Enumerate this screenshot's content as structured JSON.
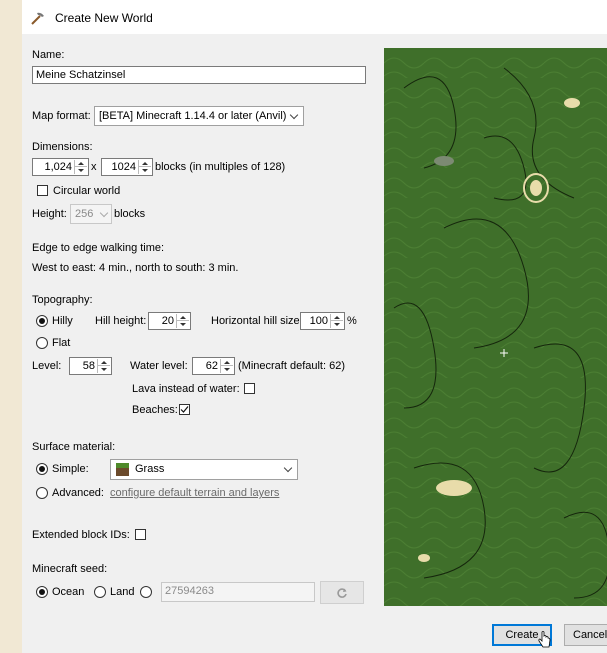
{
  "window": {
    "title": "Create New World"
  },
  "name": {
    "label": "Name:",
    "value": "Meine Schatzinsel"
  },
  "map_format": {
    "label": "Map format:",
    "value": "[BETA] Minecraft 1.14.4 or later (Anvil)"
  },
  "dimensions": {
    "label": "Dimensions:",
    "width": "1,024",
    "x_sep": "x",
    "height": "1024",
    "unit_text": "blocks (in multiples of 128)",
    "circular_label": "Circular world",
    "circular_checked": false
  },
  "height": {
    "label": "Height:",
    "value": "256",
    "unit": "blocks"
  },
  "walking": {
    "title": "Edge to edge walking time:",
    "text": "West to east: 4 min., north to south: 3 min."
  },
  "topography": {
    "label": "Topography:",
    "hilly_label": "Hilly",
    "flat_label": "Flat",
    "selected": "Hilly",
    "hill_height_label": "Hill height:",
    "hill_height": "20",
    "hill_size_label": "Horizontal hill size:",
    "hill_size": "100",
    "hill_size_unit": "%",
    "level_label": "Level:",
    "level": "58",
    "water_level_label": "Water level:",
    "water_level": "62",
    "water_default": "(Minecraft default: 62)",
    "lava_label": "Lava instead of water:",
    "lava_checked": false,
    "beaches_label": "Beaches:",
    "beaches_checked": true
  },
  "surface": {
    "label": "Surface material:",
    "simple_label": "Simple:",
    "material": "Grass",
    "advanced_label": "Advanced:",
    "advanced_link": "configure default terrain and layers",
    "selected": "Simple"
  },
  "extended_ids": {
    "label": "Extended block IDs:",
    "checked": false
  },
  "seed": {
    "label": "Minecraft seed:",
    "ocean_label": "Ocean",
    "land_label": "Land",
    "selected": "Ocean",
    "value": "27594263"
  },
  "buttons": {
    "create": "Create",
    "cancel": "Cancel"
  },
  "colors": {
    "map_green": "#3f6f2a",
    "sand": "#e8dcaa",
    "default_button": "#0078d7"
  },
  "icons": {
    "title": "pickaxe-icon",
    "material": "grass-block-icon",
    "reseed": "refresh-icon"
  }
}
